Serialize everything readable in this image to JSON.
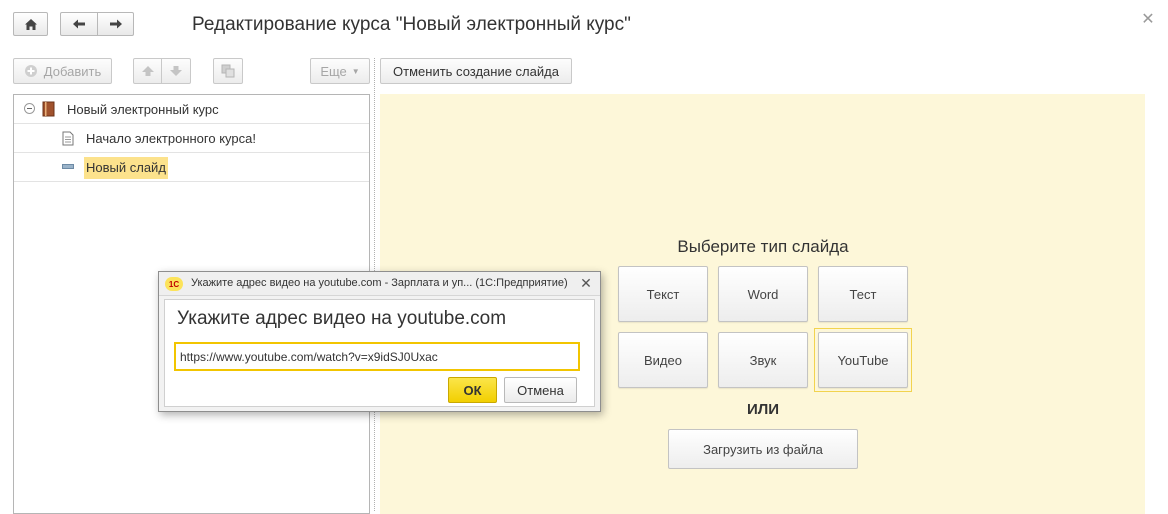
{
  "window": {
    "title": "Редактирование курса \"Новый электронный курс\""
  },
  "toolbar": {
    "add_label": "Добавить",
    "more_label": "Еще",
    "cancel_creation_label": "Отменить создание слайда"
  },
  "tree": {
    "items": [
      {
        "label": "Новый электронный курс",
        "icon": "book-icon"
      },
      {
        "label": "Начало электронного курса!",
        "icon": "document-icon"
      },
      {
        "label": "Новый слайд",
        "icon": "slide-icon",
        "selected": true
      }
    ]
  },
  "slide_type": {
    "title": "Выберите тип слайда",
    "tiles": [
      "Текст",
      "Word",
      "Тест",
      "Видео",
      "Звук",
      "YouTube"
    ],
    "focused": "YouTube",
    "or_label": "ИЛИ",
    "upload_label": "Загрузить из файла"
  },
  "dialog": {
    "title": "Укажите адрес видео на youtube.com - Зарплата и уп...  (1С:Предприятие)",
    "logo_text": "1С",
    "heading": "Укажите адрес видео на youtube.com",
    "input_value": "https://www.youtube.com/watch?v=x9idSJ0Uxac",
    "ok_label": "ОК",
    "cancel_label": "Отмена"
  },
  "colors": {
    "panel_background": "#fdf7d9",
    "selection": "#fce28c",
    "accent_yellow": "#f2cf00"
  }
}
